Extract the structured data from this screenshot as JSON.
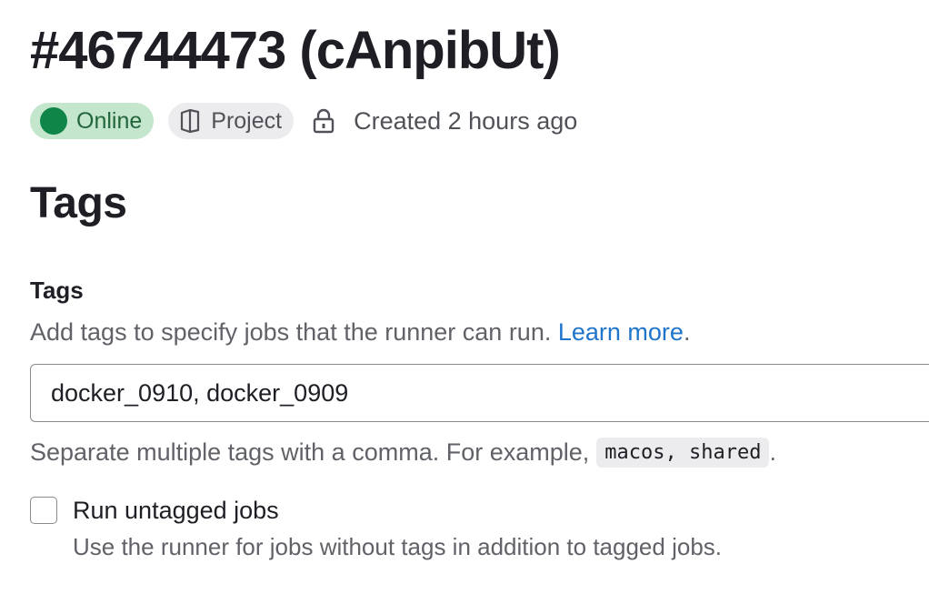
{
  "runner": {
    "title": "#46744473 (cAnpibUt)",
    "status_label": "Online",
    "type_label": "Project",
    "created_text": "Created 2 hours ago"
  },
  "section": {
    "title": "Tags"
  },
  "tags_field": {
    "label": "Tags",
    "help_text": "Add tags to specify jobs that the runner can run.",
    "learn_more_label": "Learn more",
    "help_suffix": ".",
    "value": "docker_0910, docker_0909",
    "description": "Separate multiple tags with a comma. For example,",
    "example_code": "macos, shared",
    "description_suffix": "."
  },
  "untagged_option": {
    "label": "Run untagged jobs",
    "help_text": "Use the runner for jobs without tags in addition to tagged jobs.",
    "checked": false
  },
  "icons": {
    "status": "status-dot-icon",
    "project": "project-icon",
    "lock": "lock-icon"
  },
  "colors": {
    "online_badge_bg": "#c3e6cd",
    "online_text": "#24663b",
    "online_dot": "#108548",
    "link": "#1f75cb"
  }
}
